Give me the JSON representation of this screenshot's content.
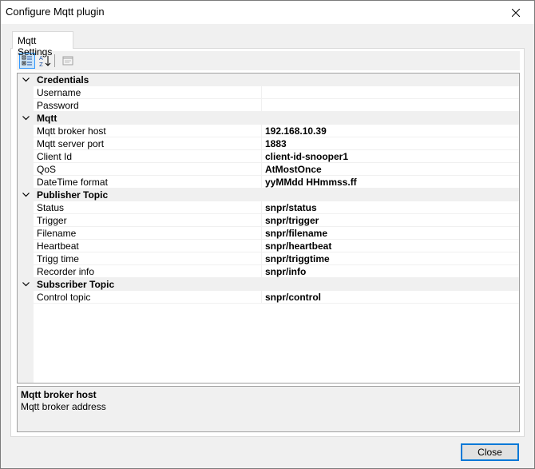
{
  "window": {
    "title": "Configure Mqtt plugin"
  },
  "tabs": [
    {
      "label": "Mqtt Settings"
    }
  ],
  "toolbar": {
    "categorized_icon": "categorized-icon",
    "alphabetical_icon": "alphabetical-icon",
    "property_pages_icon": "property-pages-icon"
  },
  "grid": {
    "categories": [
      {
        "label": "Credentials",
        "properties": [
          {
            "name": "Username",
            "value": ""
          },
          {
            "name": "Password",
            "value": ""
          }
        ]
      },
      {
        "label": "Mqtt",
        "properties": [
          {
            "name": "Mqtt broker host",
            "value": "192.168.10.39"
          },
          {
            "name": "Mqtt server port",
            "value": "1883"
          },
          {
            "name": "Client Id",
            "value": "client-id-snooper1"
          },
          {
            "name": "QoS",
            "value": "AtMostOnce"
          },
          {
            "name": "DateTime format",
            "value": "yyMMdd HHmmss.ff"
          }
        ]
      },
      {
        "label": "Publisher Topic",
        "properties": [
          {
            "name": "Status",
            "value": "snpr/status"
          },
          {
            "name": "Trigger",
            "value": "snpr/trigger"
          },
          {
            "name": "Filename",
            "value": "snpr/filename"
          },
          {
            "name": "Heartbeat",
            "value": "snpr/heartbeat"
          },
          {
            "name": "Trigg time",
            "value": "snpr/triggtime"
          },
          {
            "name": "Recorder info",
            "value": "snpr/info"
          }
        ]
      },
      {
        "label": "Subscriber Topic",
        "properties": [
          {
            "name": "Control topic",
            "value": "snpr/control"
          }
        ]
      }
    ]
  },
  "help": {
    "title": "Mqtt broker host",
    "description": "Mqtt broker address"
  },
  "buttons": {
    "close_label": "Close"
  }
}
